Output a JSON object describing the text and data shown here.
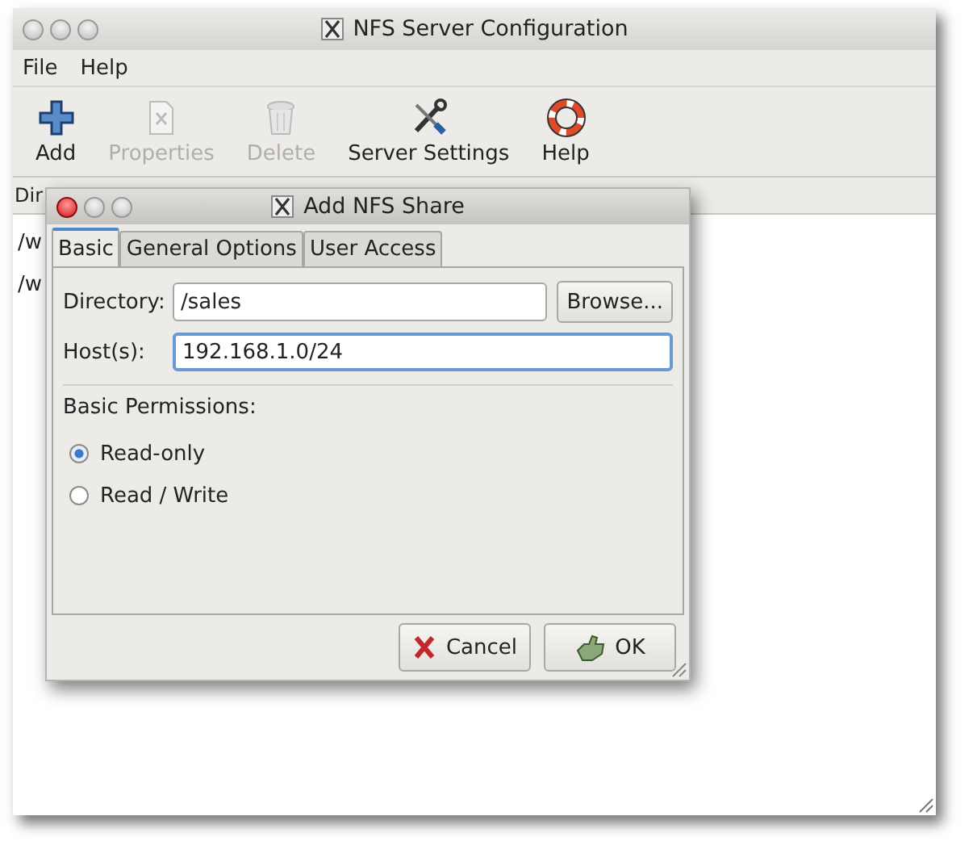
{
  "window": {
    "title": "NFS Server Configuration"
  },
  "menu": [
    {
      "label": "File"
    },
    {
      "label": "Help"
    }
  ],
  "toolbar": [
    {
      "label": "Add",
      "kind": "add",
      "disabled": false
    },
    {
      "label": "Properties",
      "kind": "properties",
      "disabled": true
    },
    {
      "label": "Delete",
      "kind": "delete",
      "disabled": true
    },
    {
      "label": "Server Settings",
      "kind": "settings",
      "disabled": false
    },
    {
      "label": "Help",
      "kind": "help",
      "disabled": false
    }
  ],
  "table": {
    "columns": [
      "Dir"
    ],
    "rows": [
      "/w",
      "/w"
    ]
  },
  "dialog": {
    "title": "Add NFS Share",
    "tabs": [
      {
        "label": "Basic",
        "selected": true
      },
      {
        "label": "General Options",
        "selected": false
      },
      {
        "label": "User Access",
        "selected": false
      }
    ],
    "directory": {
      "label": "Directory:",
      "value": "/sales",
      "button": "Browse..."
    },
    "hosts": {
      "label": "Host(s):",
      "value": "192.168.1.0/24"
    },
    "permissions_label": "Basic Permissions:",
    "permissions": [
      {
        "label": "Read-only",
        "selected": true
      },
      {
        "label": "Read / Write",
        "selected": false
      }
    ],
    "buttons": [
      {
        "label": "Cancel",
        "kind": "cancel"
      },
      {
        "label": "OK",
        "kind": "ok"
      }
    ]
  }
}
